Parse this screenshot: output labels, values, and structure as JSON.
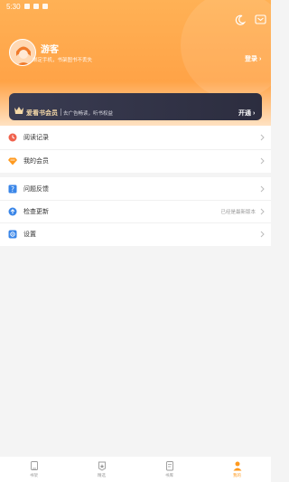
{
  "status_bar": {
    "time": "5:30"
  },
  "header": {
    "username": "游客",
    "subtitle": "绑定手机，书架图书不丢失",
    "login_label": "登录 ›"
  },
  "vip": {
    "title": "爱看书会员",
    "description": "去广告畅读，听书权益",
    "action_label": "开通 ›"
  },
  "menu": {
    "group1": [
      {
        "label": "阅读记录",
        "icon": "clock-icon",
        "extra": ""
      },
      {
        "label": "我的会员",
        "icon": "diamond-icon",
        "extra": ""
      }
    ],
    "group2": [
      {
        "label": "问题反馈",
        "icon": "question-icon",
        "extra": ""
      },
      {
        "label": "检查更新",
        "icon": "upload-icon",
        "extra": "已经是最新版本"
      },
      {
        "label": "设置",
        "icon": "gear-icon",
        "extra": ""
      }
    ]
  },
  "tabbar": [
    {
      "label": "书架",
      "icon": "bookshelf-icon",
      "active": false
    },
    {
      "label": "精选",
      "icon": "featured-icon",
      "active": false
    },
    {
      "label": "书库",
      "icon": "library-icon",
      "active": false
    },
    {
      "label": "我的",
      "icon": "profile-icon",
      "active": true
    }
  ],
  "colors": {
    "header_gradient_top": "#ffb155",
    "accent": "#ff9a1f",
    "vip_background": "#2c2d3f",
    "vip_gold": "#f5d9a8"
  }
}
